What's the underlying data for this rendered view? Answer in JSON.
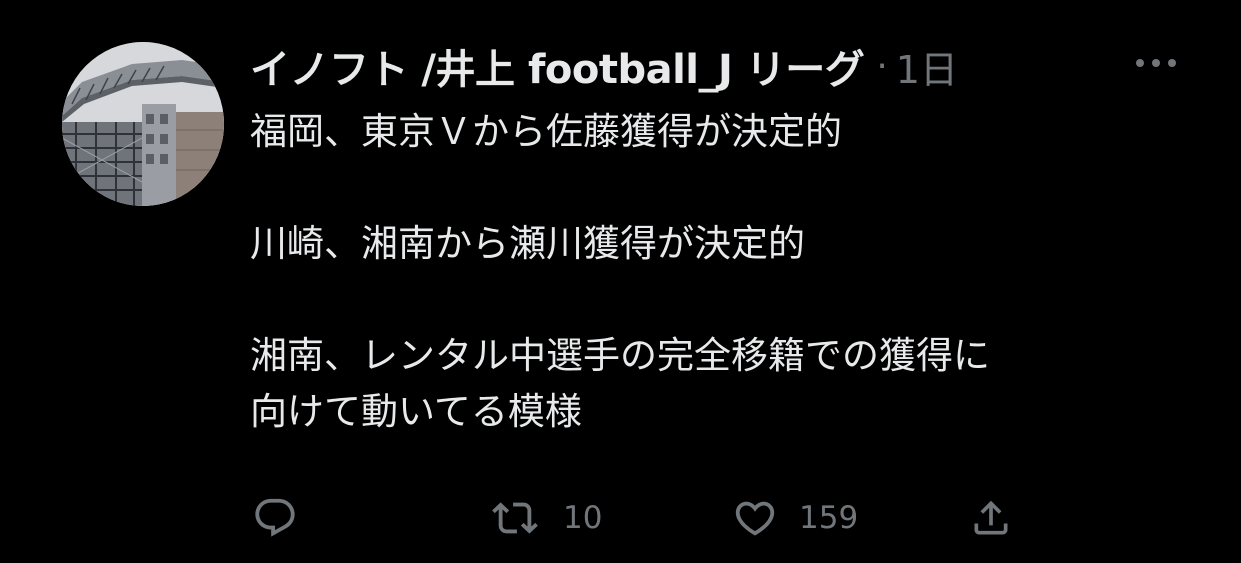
{
  "tweet": {
    "author": {
      "display_name": "イノフト /井上 football_J リーグ"
    },
    "separator": "·",
    "timestamp": "1日",
    "text_lines": [
      "福岡、東京Ｖから佐藤獲得が決定的",
      "",
      "川崎、湘南から瀬川獲得が決定的",
      "",
      "湘南、レンタル中選手の完全移籍での獲得に",
      "向けて動いてる模様"
    ],
    "actions": {
      "reply_icon": "reply-icon",
      "retweet_icon": "retweet-icon",
      "retweet_count": "10",
      "like_icon": "heart-icon",
      "like_count": "159",
      "share_icon": "share-icon"
    },
    "more_icon": "more-icon"
  },
  "colors": {
    "background": "#000000",
    "text_primary": "#e7e9ea",
    "text_secondary": "#71767b"
  }
}
